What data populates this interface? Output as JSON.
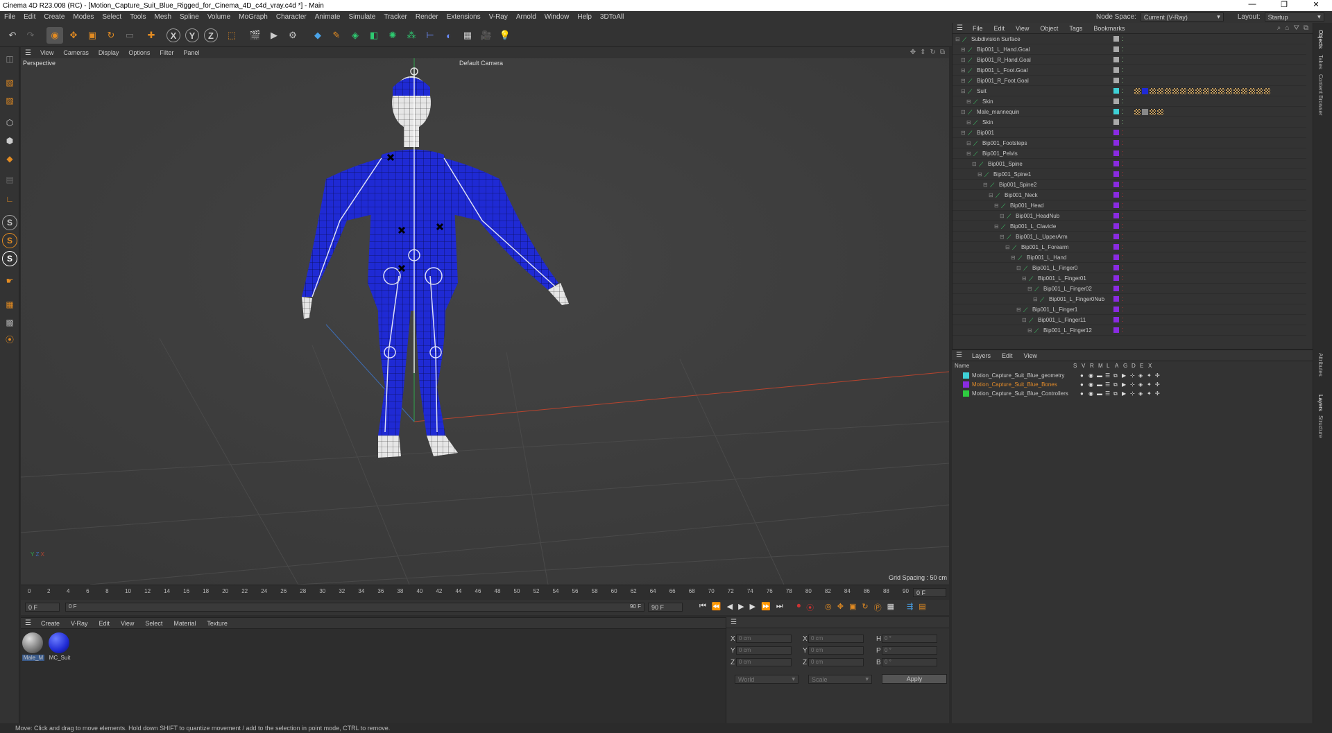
{
  "window": {
    "title": "Cinema 4D R23.008 (RC) - [Motion_Capture_Suit_Blue_Rigged_for_Cinema_4D_c4d_vray.c4d *] - Main",
    "min": "—",
    "max": "❐",
    "close": "✕"
  },
  "menu": [
    "File",
    "Edit",
    "Create",
    "Modes",
    "Select",
    "Tools",
    "Mesh",
    "Spline",
    "Volume",
    "MoGraph",
    "Character",
    "Animate",
    "Simulate",
    "Tracker",
    "Render",
    "Extensions",
    "V-Ray",
    "Arnold",
    "Window",
    "Help",
    "3DToAll"
  ],
  "node_space": {
    "label": "Node Space:",
    "value": "Current (V-Ray)"
  },
  "layout": {
    "label": "Layout:",
    "value": "Startup"
  },
  "viewport": {
    "menu": [
      "View",
      "Cameras",
      "Display",
      "Options",
      "Filter",
      "Panel"
    ],
    "view_name": "Perspective",
    "camera": "Default Camera",
    "grid_spacing": "Grid Spacing : 50 cm"
  },
  "timeline": {
    "ticks": [
      "0",
      "2",
      "4",
      "6",
      "8",
      "10",
      "12",
      "14",
      "16",
      "18",
      "20",
      "22",
      "24",
      "26",
      "28",
      "30",
      "32",
      "34",
      "36",
      "38",
      "40",
      "42",
      "44",
      "46",
      "48",
      "50",
      "52",
      "54",
      "56",
      "58",
      "60",
      "62",
      "64",
      "66",
      "68",
      "70",
      "72",
      "74",
      "76",
      "78",
      "80",
      "82",
      "84",
      "86",
      "88",
      "90"
    ],
    "current": "0 F"
  },
  "transport": {
    "start": "0 F",
    "pos": "0 F",
    "end_inner": "90 F",
    "end": "90 F"
  },
  "materials": {
    "menu": [
      "Create",
      "V-Ray",
      "Edit",
      "View",
      "Select",
      "Material",
      "Texture"
    ],
    "items": [
      {
        "name": "Male_M"
      },
      {
        "name": "MC_Suit"
      }
    ]
  },
  "coords": {
    "x": "X",
    "y": "Y",
    "z": "Z",
    "px": "0 cm",
    "py": "0 cm",
    "pz": "0 cm",
    "sx": "0 cm",
    "sy": "0 cm",
    "sz": "0 cm",
    "h": "H",
    "p": "P",
    "b": "B",
    "hv": "0 °",
    "pv": "0 °",
    "bv": "0 °",
    "world": "World",
    "scale": "Scale",
    "apply": "Apply"
  },
  "objects": {
    "menu": [
      "File",
      "Edit",
      "View",
      "Object",
      "Tags",
      "Bookmarks"
    ],
    "rows": [
      {
        "name": "Subdivision Surface",
        "indent": 0,
        "color": "#c8c8c8"
      },
      {
        "name": "Bip001_L_Hand.Goal",
        "indent": 1,
        "color": "#c8c8c8"
      },
      {
        "name": "Bip001_R_Hand.Goal",
        "indent": 1,
        "color": "#c8c8c8"
      },
      {
        "name": "Bip001_L_Foot.Goal",
        "indent": 1,
        "color": "#c8c8c8"
      },
      {
        "name": "Bip001_R_Foot.Goal",
        "indent": 1,
        "color": "#c8c8c8"
      },
      {
        "name": "Suit",
        "indent": 1,
        "color": "#c8c8c8"
      },
      {
        "name": "Skin",
        "indent": 2,
        "color": "#c8c8c8"
      },
      {
        "name": "Male_mannequin",
        "indent": 1,
        "color": "#c8c8c8"
      },
      {
        "name": "Skin",
        "indent": 2,
        "color": "#c8c8c8"
      },
      {
        "name": "Bip001",
        "indent": 1,
        "color": "#c8c8c8"
      },
      {
        "name": "Bip001_Footsteps",
        "indent": 2,
        "color": "#c8c8c8"
      },
      {
        "name": "Bip001_Pelvis",
        "indent": 2,
        "color": "#c8c8c8"
      },
      {
        "name": "Bip001_Spine",
        "indent": 3,
        "color": "#c8c8c8"
      },
      {
        "name": "Bip001_Spine1",
        "indent": 4,
        "color": "#c8c8c8"
      },
      {
        "name": "Bip001_Spine2",
        "indent": 5,
        "color": "#c8c8c8"
      },
      {
        "name": "Bip001_Neck",
        "indent": 6,
        "color": "#c8c8c8"
      },
      {
        "name": "Bip001_Head",
        "indent": 7,
        "color": "#c8c8c8"
      },
      {
        "name": "Bip001_HeadNub",
        "indent": 8,
        "color": "#c8c8c8"
      },
      {
        "name": "Bip001_L_Clavicle",
        "indent": 7,
        "color": "#c8c8c8"
      },
      {
        "name": "Bip001_L_UpperArm",
        "indent": 8,
        "color": "#c8c8c8"
      },
      {
        "name": "Bip001_L_Forearm",
        "indent": 9,
        "color": "#c8c8c8"
      },
      {
        "name": "Bip001_L_Hand",
        "indent": 10,
        "color": "#c8c8c8"
      },
      {
        "name": "Bip001_L_Finger0",
        "indent": 11,
        "color": "#c8c8c8"
      },
      {
        "name": "Bip001_L_Finger01",
        "indent": 12,
        "color": "#c8c8c8"
      },
      {
        "name": "Bip001_L_Finger02",
        "indent": 13,
        "color": "#c8c8c8"
      },
      {
        "name": "Bip001_L_Finger0Nub",
        "indent": 14,
        "color": "#c8c8c8"
      },
      {
        "name": "Bip001_L_Finger1",
        "indent": 11,
        "color": "#c8c8c8"
      },
      {
        "name": "Bip001_L_Finger11",
        "indent": 12,
        "color": "#c8c8c8"
      },
      {
        "name": "Bip001_L_Finger12",
        "indent": 13,
        "color": "#c8c8c8"
      }
    ]
  },
  "layers": {
    "menu": [
      "Layers",
      "Edit",
      "View"
    ],
    "cols": [
      "Name",
      "S",
      "V",
      "R",
      "M",
      "L",
      "A",
      "G",
      "D",
      "E",
      "X"
    ],
    "rows": [
      {
        "name": "Motion_Capture_Suit_Blue_geometry",
        "color": "#3ed1d6",
        "text": "#c8c8c8"
      },
      {
        "name": "Motion_Capture_Suit_Blue_Bones",
        "color": "#8a2be2",
        "text": "#e08a2a"
      },
      {
        "name": "Motion_Capture_Suit_Blue_Controllers",
        "color": "#2ecc40",
        "text": "#c8c8c8"
      }
    ]
  },
  "right_tabs": [
    "Objects",
    "Takes",
    "Content Browser",
    "Attributes",
    "Layers",
    "Structure"
  ],
  "status": "Move: Click and drag to move elements. Hold down SHIFT to quantize movement / add to the selection in point mode, CTRL to remove.",
  "colors": {
    "accent": "#e28b22",
    "suit": "#1f2ad4"
  }
}
